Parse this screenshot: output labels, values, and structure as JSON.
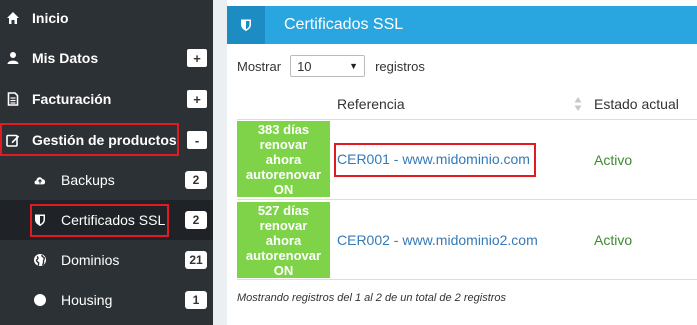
{
  "sidebar": {
    "items": [
      {
        "label": "Inicio",
        "icon": "home-icon"
      },
      {
        "label": "Mis Datos",
        "icon": "user-icon",
        "toggle": "+"
      },
      {
        "label": "Facturación",
        "icon": "document-icon",
        "toggle": "+"
      },
      {
        "label": "Gestión de productos",
        "icon": "edit-icon",
        "toggle": "-"
      },
      {
        "label": "Backups",
        "icon": "cloud-upload-icon",
        "count": "2"
      },
      {
        "label": "Certificados SSL",
        "icon": "shield-icon",
        "count": "2"
      },
      {
        "label": "Dominios",
        "icon": "globe-icon",
        "count": "21"
      },
      {
        "label": "Housing",
        "icon": "circle-icon",
        "count": "1"
      }
    ]
  },
  "panel": {
    "title": "Certificados SSL",
    "show_label": "Mostrar",
    "page_size": "10",
    "records_label": "registros",
    "columns": [
      "Referencia",
      "Estado actual"
    ],
    "rows": [
      {
        "status_lines": [
          "383 días",
          "renovar ahora",
          "autorenovar",
          "ON"
        ],
        "reference": "CER001 - www.midominio.com",
        "estado": "Activo"
      },
      {
        "status_lines": [
          "527 días",
          "renovar ahora",
          "autorenovar",
          "ON"
        ],
        "reference": "CER002 - www.midominio2.com",
        "estado": "Activo"
      }
    ],
    "footer": "Mostrando registros del 1 al 2 de un total de 2 registros"
  },
  "colors": {
    "sidebar_bg": "#2c3136",
    "header_blue": "#29a5df",
    "status_green": "#7ed348",
    "highlight_red": "#e01b24",
    "link_blue": "#337ab7"
  }
}
